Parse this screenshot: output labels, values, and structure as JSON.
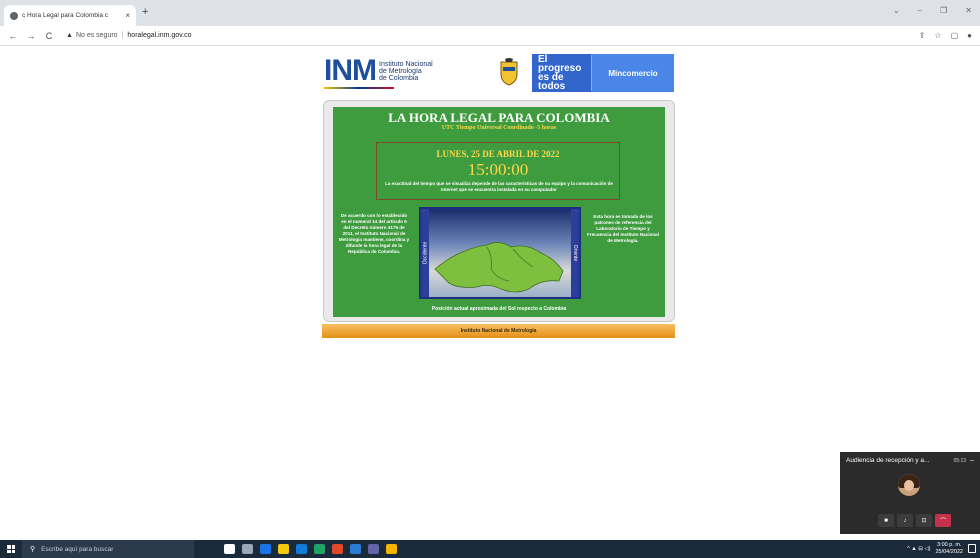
{
  "browser": {
    "tab_title": "c Hora Legal para Colombia c",
    "tab_close": "×",
    "new_tab": "+",
    "security_text": "No es seguro",
    "url": "horalegal.inm.gov.co",
    "nav_back": "←",
    "nav_forward": "→",
    "nav_reload": "C",
    "warning_glyph": "▲",
    "win_min": "–",
    "win_restore": "❐",
    "win_close": "✕",
    "win_chevron": "⌄",
    "share_glyph": "⇪",
    "star_glyph": "☆",
    "sidepanel_glyph": "▢",
    "profile_glyph": "●"
  },
  "header": {
    "inm_mark": "INM",
    "inm_line1": "Instituto Nacional",
    "inm_line2": "de Metrología",
    "inm_line3": "de Colombia",
    "gov_slogan": "El progreso es de todos",
    "ministry": "Mincomercio"
  },
  "clock": {
    "title": "LA HORA LEGAL PARA COLOMBIA",
    "subtitle": "UTC Tiempo Universal Coordinado -5 horas",
    "date": "LUNES, 25 DE ABRIL DE 2022",
    "time": "15:00:00",
    "note": "La exactitud del tiempo que se visualiza depende de las características de su equipo y la comunicación de Internet que se encuentra instalada en su computador",
    "left_text": "De acuerdo con lo establecido en el numeral 14 del artículo 6 del Decreto número 4175 de 2011, el Instituto Nacional de Metrología mantiene, coordina y difunde la hora legal de la República de Colombia.",
    "right_text": "Esta hora es tomada de los patrones de referencia del Laboratorio de Tiempo y Frecuencia del Instituto Nacional de Metrología.",
    "west_label": "Occidente",
    "east_label": "Oriente",
    "caption": "Posición actual aproximada del Sol respecto a Colombia",
    "footer": "Instituto Nacional de Metrología"
  },
  "meeting": {
    "title": "Audiencia de recepción y a...",
    "duration": "05:13",
    "minimize": "–",
    "controls": [
      "■",
      "♪",
      "⊡",
      "⌒"
    ]
  },
  "taskbar": {
    "search_placeholder": "Escribe aquí para buscar",
    "search_glyph": "⚲",
    "time": "3:00 p. m.",
    "date": "25/04/2022",
    "tray_glyph": "^ ▲ ⊟ ◁)",
    "icon_colors": [
      "#ffffff",
      "#9aa7b4",
      "#1a73e8",
      "#f2c811",
      "#0f7bd6",
      "#21a366",
      "#e2492b",
      "#2b7cd3",
      "#6264a7",
      "#f4b400"
    ]
  },
  "colors": {
    "page_green": "#3e9b3e",
    "gold_text": "#ffd84a",
    "gov_blue": "#3366cc",
    "footer_orange": "#e58f15"
  }
}
